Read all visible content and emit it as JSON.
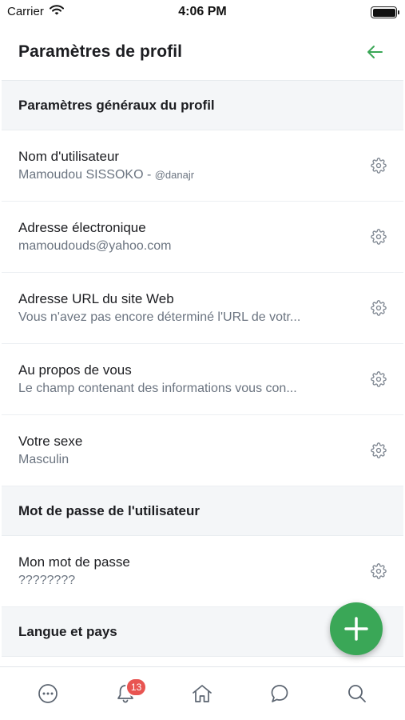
{
  "status_bar": {
    "carrier": "Carrier",
    "time": "4:06 PM"
  },
  "header": {
    "title": "Paramètres de profil",
    "back_icon": "arrow-left-icon",
    "accent": "#3aa757"
  },
  "sections": [
    {
      "title": "Paramètres généraux du profil",
      "rows": [
        {
          "label": "Nom d'utilisateur",
          "value": "Mamoudou SISSOKO - ",
          "handle": "@danajr"
        },
        {
          "label": "Adresse électronique",
          "value": "mamoudouds@yahoo.com"
        },
        {
          "label": "Adresse URL du site Web",
          "value": "Vous n'avez pas encore déterminé l'URL de votr..."
        },
        {
          "label": "Au propos de vous",
          "value": "Le champ contenant des informations vous con..."
        },
        {
          "label": "Votre sexe",
          "value": "Masculin"
        }
      ]
    },
    {
      "title": "Mot de passe de l'utilisateur",
      "rows": [
        {
          "label": "Mon mot de passe",
          "value": "????????"
        }
      ]
    },
    {
      "title": "Langue et pays",
      "rows": []
    }
  ],
  "fab": {
    "icon": "plus-icon",
    "color": "#3aa757"
  },
  "tabbar": {
    "items": [
      {
        "icon": "more-icon"
      },
      {
        "icon": "bell-icon",
        "badge": "13"
      },
      {
        "icon": "home-icon"
      },
      {
        "icon": "chat-icon"
      },
      {
        "icon": "search-icon"
      }
    ],
    "badge_color": "#e85451"
  }
}
